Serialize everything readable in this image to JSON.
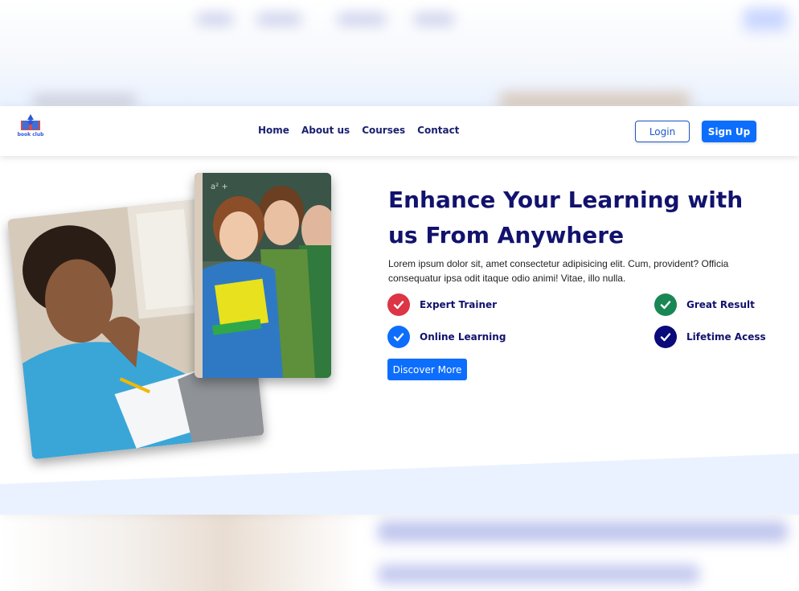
{
  "brand": {
    "logo_text": "book club"
  },
  "nav": {
    "links": [
      "Home",
      "About us",
      "Courses",
      "Contact"
    ],
    "login_label": "Login",
    "signup_label": "Sign Up"
  },
  "hero": {
    "title": "Enhance Your Learning with us From Anywhere",
    "description": "Lorem ipsum dolor sit, amet consectetur adipisicing elit. Cum, provident? Officia consequatur ipsa odit itaque odio animi! Vitae, illo nulla.",
    "features": [
      {
        "label": "Expert Trainer",
        "icon": "check-icon",
        "color": "#dc3545"
      },
      {
        "label": "Great Result",
        "icon": "check-icon",
        "color": "#198754"
      },
      {
        "label": "Online Learning",
        "icon": "check-icon",
        "color": "#0d6efd"
      },
      {
        "label": "Lifetime Acess",
        "icon": "check-icon",
        "color": "#0a0a7a"
      }
    ],
    "cta_label": "Discover More"
  },
  "colors": {
    "primary": "#0d6efd",
    "heading": "#12126e",
    "wave": "#eaf2ff"
  }
}
